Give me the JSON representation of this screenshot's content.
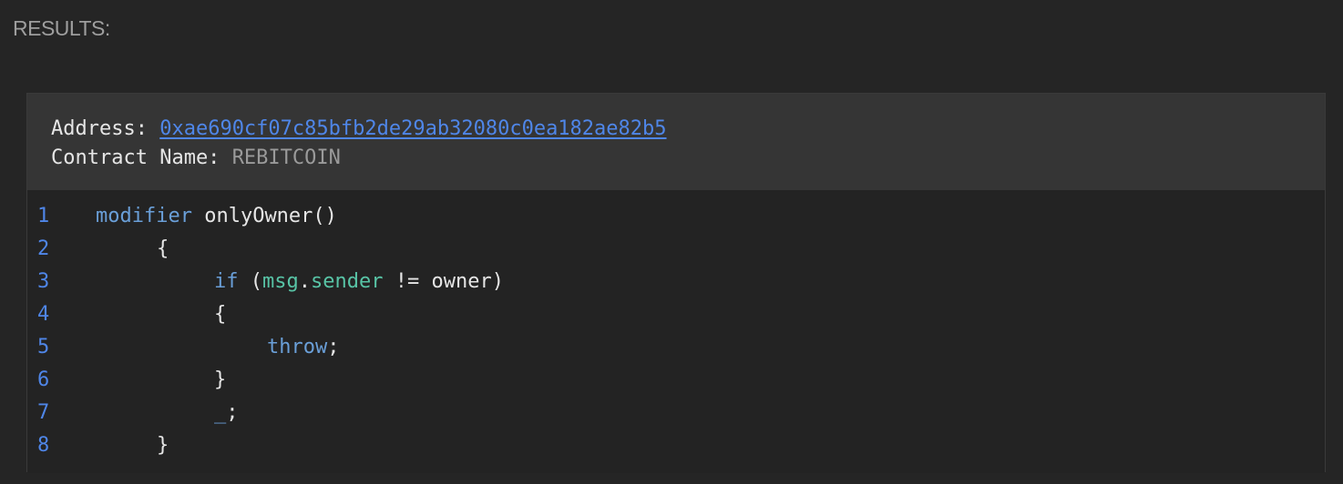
{
  "results_label": "RESULTS:",
  "contract": {
    "address_key": "Address: ",
    "address": "0xae690cf07c85bfb2de29ab32080c0ea182ae82b5",
    "name_key": "Contract Name: ",
    "name": "REBITCOIN"
  },
  "code": {
    "lines": [
      {
        "no": "1",
        "tokens": [
          {
            "t": "modifier",
            "c": "kw"
          },
          {
            "t": " onlyOwner()",
            "c": "plain"
          }
        ]
      },
      {
        "no": "2",
        "tokens": [
          {
            "t": "{",
            "c": "plain"
          }
        ]
      },
      {
        "no": "3",
        "tokens": [
          {
            "t": "if",
            "c": "kw"
          },
          {
            "t": " (",
            "c": "plain"
          },
          {
            "t": "msg",
            "c": "obj"
          },
          {
            "t": ".",
            "c": "plain"
          },
          {
            "t": "sender",
            "c": "obj"
          },
          {
            "t": " != owner)",
            "c": "plain"
          }
        ]
      },
      {
        "no": "4",
        "tokens": [
          {
            "t": "{",
            "c": "plain"
          }
        ]
      },
      {
        "no": "5",
        "tokens": [
          {
            "t": "throw",
            "c": "kw"
          },
          {
            "t": ";",
            "c": "plain"
          }
        ]
      },
      {
        "no": "6",
        "tokens": [
          {
            "t": "}",
            "c": "plain"
          }
        ]
      },
      {
        "no": "7",
        "tokens": [
          {
            "t": "_",
            "c": "kw"
          },
          {
            "t": ";",
            "c": "plain"
          }
        ]
      },
      {
        "no": "8",
        "tokens": [
          {
            "t": "}",
            "c": "plain"
          }
        ]
      }
    ]
  },
  "colors": {
    "background": "#252525",
    "header": "#353535",
    "link": "#4f86e8",
    "keyword": "#6a9fd8",
    "identifier": "#58c4a6",
    "text": "#e6e6e6",
    "muted": "#9a9a9a"
  }
}
